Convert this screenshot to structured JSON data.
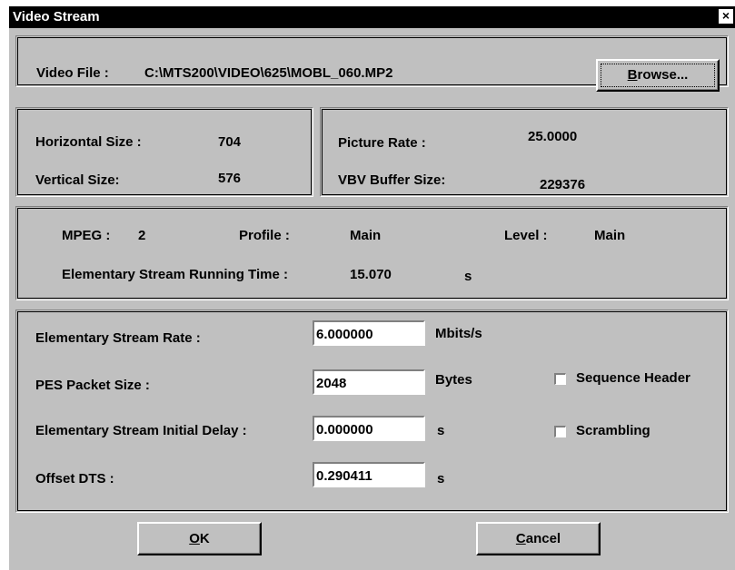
{
  "window": {
    "title": "Video Stream",
    "close_glyph": "×"
  },
  "file": {
    "label": "Video File :",
    "path": "C:\\MTS200\\VIDEO\\625\\MOBL_060.MP2",
    "browse_first": "B",
    "browse_rest": "rowse..."
  },
  "dimensions": {
    "horizontal_label": "Horizontal Size :",
    "horizontal_value": "704",
    "vertical_label": "Vertical Size:",
    "vertical_value": "576"
  },
  "rates": {
    "picture_rate_label": "Picture Rate :",
    "picture_rate_value": "25.0000",
    "vbv_label": "VBV Buffer Size:",
    "vbv_value": "229376"
  },
  "mpeg": {
    "mpeg_label": "MPEG :",
    "mpeg_value": "2",
    "profile_label": "Profile :",
    "profile_value": "Main",
    "level_label": "Level :",
    "level_value": "Main",
    "running_time_label": "Elementary Stream Running Time :",
    "running_time_value": "15.070",
    "running_time_unit": "s"
  },
  "params": {
    "rate_label": "Elementary Stream Rate :",
    "rate_value": "6.000000",
    "rate_unit": "Mbits/s",
    "pes_label": "PES Packet Size :",
    "pes_value": "2048",
    "pes_unit": "Bytes",
    "delay_label": "Elementary Stream Initial Delay :",
    "delay_value": "0.000000",
    "delay_unit": "s",
    "dts_label": "Offset DTS :",
    "dts_value": "0.290411",
    "dts_unit": "s",
    "sequence_header_label": "Sequence Header",
    "sequence_header_checked": false,
    "scrambling_label": "Scrambling",
    "scrambling_checked": false
  },
  "buttons": {
    "ok_first": "O",
    "ok_rest": "K",
    "cancel_first": "C",
    "cancel_rest": "ancel"
  }
}
